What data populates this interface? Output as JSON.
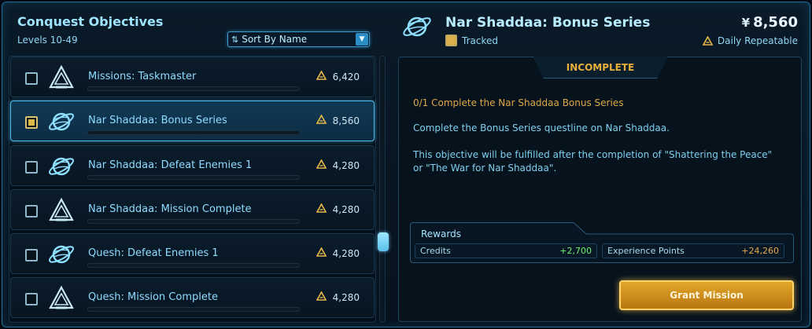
{
  "left": {
    "title": "Conquest Objectives",
    "levels": "Levels 10-49",
    "sort_label": "Sort By Name"
  },
  "objectives": [
    {
      "name": "Missions: Taskmaster",
      "points": "6,420",
      "icon": "conquest-chevron-icon",
      "tracked": false,
      "selected": false
    },
    {
      "name": "Nar Shaddaa: Bonus Series",
      "points": "8,560",
      "icon": "planet-ring-icon",
      "tracked": true,
      "selected": true
    },
    {
      "name": "Nar Shaddaa: Defeat Enemies 1",
      "points": "4,280",
      "icon": "planet-ring-icon",
      "tracked": false,
      "selected": false
    },
    {
      "name": "Nar Shaddaa: Mission Complete",
      "points": "4,280",
      "icon": "conquest-chevron-icon",
      "tracked": false,
      "selected": false
    },
    {
      "name": "Quesh: Defeat Enemies 1",
      "points": "4,280",
      "icon": "planet-ring-icon",
      "tracked": false,
      "selected": false
    },
    {
      "name": "Quesh: Mission Complete",
      "points": "4,280",
      "icon": "conquest-chevron-icon",
      "tracked": false,
      "selected": false
    }
  ],
  "detail": {
    "title": "Nar Shaddaa: Bonus Series",
    "tracked_label": "Tracked",
    "value": "8,560",
    "currency_symbol": "¥",
    "repeat_label": "Daily Repeatable",
    "status": "INCOMPLETE",
    "progress_line": "0/1 Complete the Nar Shaddaa Bonus Series",
    "description": "Complete the Bonus Series questline on Nar Shaddaa.",
    "note": "This objective will be fulfilled after the completion of \"Shattering the Peace\" or \"The War for Nar Shaddaa\".",
    "rewards_label": "Rewards",
    "credits_label": "Credits",
    "credits_value": "+2,700",
    "xp_label": "Experience Points",
    "xp_value": "+24,260",
    "grant_label": "Grant Mission"
  },
  "colors": {
    "accent": "#4fc0ef",
    "gold": "#e0b848",
    "status": "#e8b03a",
    "credits": "#6cf06c",
    "xp": "#e8a84a"
  }
}
